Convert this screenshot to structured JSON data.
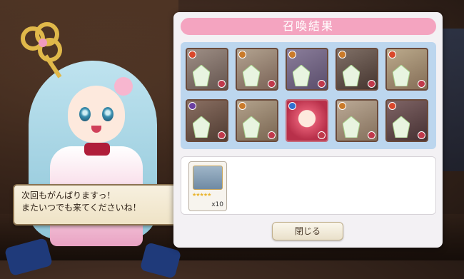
{
  "panel": {
    "title": "召喚結果",
    "close_label": "閉じる"
  },
  "dialog": {
    "lines": [
      "次回もがんばりますっ！",
      "またいつでも来てくださいね！"
    ]
  },
  "results": [
    {
      "attr": "fire",
      "attr_color": "#d9472b",
      "crystal": true
    },
    {
      "attr": "earth",
      "attr_color": "#c97a2a",
      "crystal": true
    },
    {
      "attr": "earth",
      "attr_color": "#c97a2a",
      "crystal": true
    },
    {
      "attr": "earth",
      "attr_color": "#c97a2a",
      "crystal": true
    },
    {
      "attr": "fire",
      "attr_color": "#d9472b",
      "crystal": true
    },
    {
      "attr": "dark",
      "attr_color": "#6a3fa0",
      "crystal": true
    },
    {
      "attr": "earth",
      "attr_color": "#c97a2a",
      "crystal": true
    },
    {
      "attr": "water",
      "attr_color": "#2f6fd0",
      "crystal": false
    },
    {
      "attr": "earth",
      "attr_color": "#c97a2a",
      "crystal": true
    },
    {
      "attr": "fire",
      "attr_color": "#d9472b",
      "crystal": true
    }
  ],
  "item": {
    "count": "x10",
    "stars": "★★★★★"
  }
}
